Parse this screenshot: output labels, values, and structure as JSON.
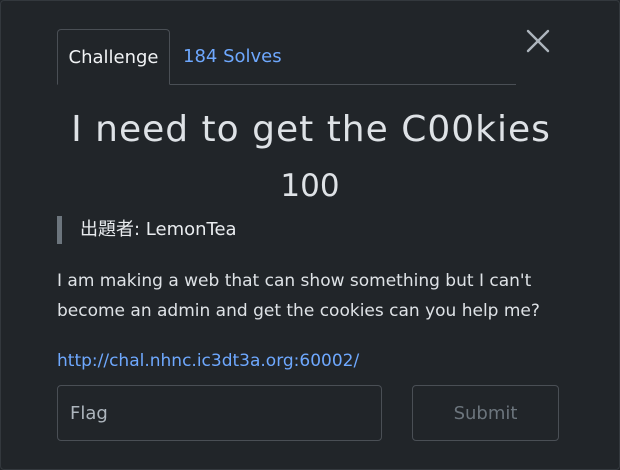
{
  "modal": {
    "tabs": [
      {
        "label": "Challenge",
        "active": true
      },
      {
        "label": "184 Solves",
        "active": false
      }
    ],
    "close_icon": "close-x-icon"
  },
  "challenge": {
    "title": "I need to get the C00kies",
    "points": "100",
    "author": "出題者: LemonTea",
    "description": "I am making a web that can show something but I can't become an admin and get the cookies can you help me?",
    "link": "http://chal.nhnc.ic3dt3a.org:60002/"
  },
  "form": {
    "flag_placeholder": "Flag",
    "flag_value": "",
    "submit_label": "Submit"
  },
  "colors": {
    "background": "#212529",
    "link": "#6ea8fe",
    "border": "#4a4f55",
    "muted": "#6c757d"
  }
}
